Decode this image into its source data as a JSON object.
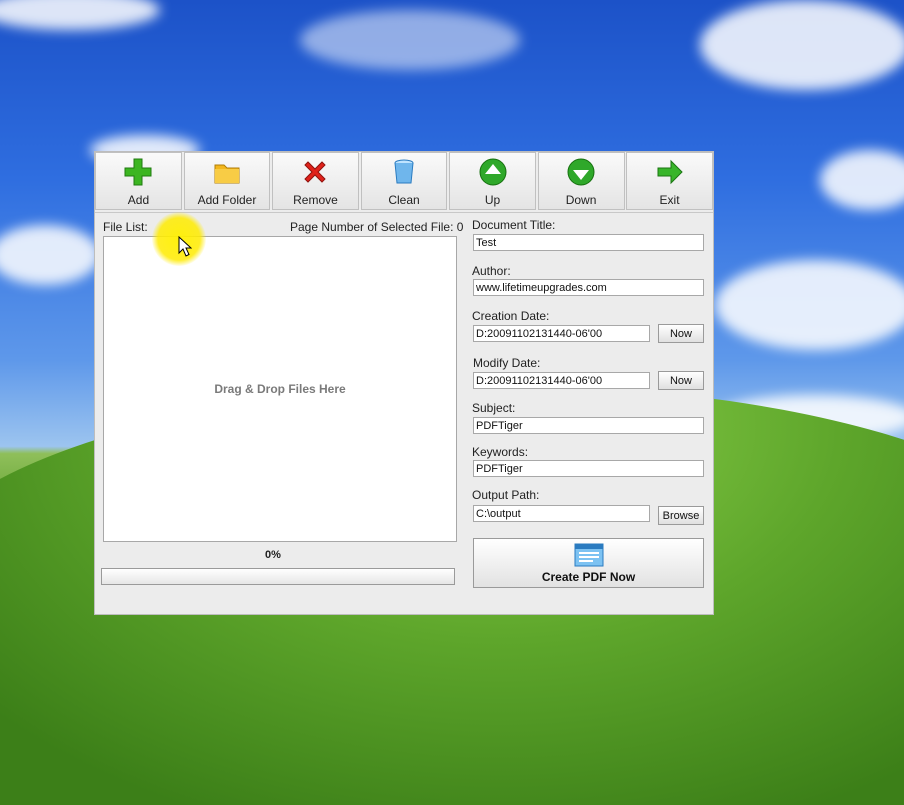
{
  "toolbar": {
    "buttons": [
      {
        "label": "Add",
        "icon": "add-icon"
      },
      {
        "label": "Add Folder",
        "icon": "folder-icon"
      },
      {
        "label": "Remove",
        "icon": "remove-icon"
      },
      {
        "label": "Clean",
        "icon": "clean-icon"
      },
      {
        "label": "Up",
        "icon": "up-icon"
      },
      {
        "label": "Down",
        "icon": "down-icon"
      },
      {
        "label": "Exit",
        "icon": "exit-icon"
      }
    ]
  },
  "file_panel": {
    "file_list_label": "File List:",
    "page_number_label": "Page Number of Selected File: 0",
    "drop_hint": "Drag & Drop Files Here",
    "progress_text": "0%",
    "progress_value": 0
  },
  "doc": {
    "title_label": "Document Title:",
    "title_value": "Test",
    "author_label": "Author:",
    "author_value": "www.lifetimeupgrades.com",
    "creation_label": "Creation Date:",
    "creation_value": "D:20091102131440-06'00",
    "modify_label": "Modify Date:",
    "modify_value": "D:20091102131440-06'00",
    "now_label": "Now",
    "subject_label": "Subject:",
    "subject_value": "PDFTiger",
    "keywords_label": "Keywords:",
    "keywords_value": "PDFTiger",
    "output_label": "Output Path:",
    "output_value": "C:\\output",
    "browse_label": "Browse",
    "create_label": "Create PDF Now"
  },
  "colors": {
    "add": "#3cb521",
    "folder": "#f3b71d",
    "remove": "#e0221b",
    "up_down": "#2fa82a",
    "exit": "#38b52a"
  }
}
